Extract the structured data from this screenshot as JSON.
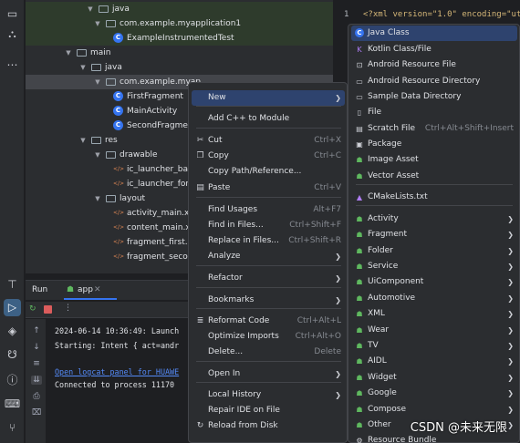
{
  "project_tree": {
    "rows": [
      {
        "label": "java",
        "type": "folder"
      },
      {
        "label": "com.example.myapplication1",
        "type": "folder"
      },
      {
        "label": "ExampleInstrumentedTest",
        "type": "class"
      },
      {
        "label": "main",
        "type": "folder"
      },
      {
        "label": "java",
        "type": "folder"
      },
      {
        "label": "com.example.myap",
        "type": "folder"
      },
      {
        "label": "FirstFragment",
        "type": "class"
      },
      {
        "label": "MainActivity",
        "type": "class"
      },
      {
        "label": "SecondFragmen",
        "type": "class"
      },
      {
        "label": "res",
        "type": "folder"
      },
      {
        "label": "drawable",
        "type": "folder"
      },
      {
        "label": "ic_launcher_back",
        "type": "xml"
      },
      {
        "label": "ic_launcher_fore",
        "type": "xml"
      },
      {
        "label": "layout",
        "type": "folder"
      },
      {
        "label": "activity_main.xm",
        "type": "xml"
      },
      {
        "label": "content_main.xm",
        "type": "xml"
      },
      {
        "label": "fragment_first.xm",
        "type": "xml"
      },
      {
        "label": "fragment_secon",
        "type": "xml"
      }
    ]
  },
  "editor": {
    "line_number": "1",
    "code_line": "<?xml version=\"1.0\" encoding=\"ut"
  },
  "run_panel": {
    "tab_run": "Run",
    "tab_app": "app",
    "lines": [
      "2024-06-14 10:36:49: Launch",
      "Starting: Intent { act=andr",
      "",
      "Open logcat panel for HUAWE",
      "Connected to process 11170"
    ]
  },
  "context_menu": {
    "items": [
      {
        "label": "New",
        "shortcut": "",
        "submenu": true,
        "icon": ""
      },
      {
        "label": "Add C++ to Module",
        "shortcut": "",
        "submenu": false,
        "icon": ""
      },
      {
        "label": "Cut",
        "shortcut": "Ctrl+X",
        "submenu": false,
        "icon": "scissors-icon"
      },
      {
        "label": "Copy",
        "shortcut": "Ctrl+C",
        "submenu": false,
        "icon": "copy-icon"
      },
      {
        "label": "Copy Path/Reference...",
        "shortcut": "",
        "submenu": false,
        "icon": ""
      },
      {
        "label": "Paste",
        "shortcut": "Ctrl+V",
        "submenu": false,
        "icon": "paste-icon"
      },
      {
        "label": "Find Usages",
        "shortcut": "Alt+F7",
        "submenu": false,
        "icon": ""
      },
      {
        "label": "Find in Files...",
        "shortcut": "Ctrl+Shift+F",
        "submenu": false,
        "icon": ""
      },
      {
        "label": "Replace in Files...",
        "shortcut": "Ctrl+Shift+R",
        "submenu": false,
        "icon": ""
      },
      {
        "label": "Analyze",
        "shortcut": "",
        "submenu": true,
        "icon": ""
      },
      {
        "label": "Refactor",
        "shortcut": "",
        "submenu": true,
        "icon": ""
      },
      {
        "label": "Bookmarks",
        "shortcut": "",
        "submenu": true,
        "icon": ""
      },
      {
        "label": "Reformat Code",
        "shortcut": "Ctrl+Alt+L",
        "submenu": false,
        "icon": "reformat-icon"
      },
      {
        "label": "Optimize Imports",
        "shortcut": "Ctrl+Alt+O",
        "submenu": false,
        "icon": ""
      },
      {
        "label": "Delete...",
        "shortcut": "Delete",
        "submenu": false,
        "icon": ""
      },
      {
        "label": "Open In",
        "shortcut": "",
        "submenu": true,
        "icon": ""
      },
      {
        "label": "Local History",
        "shortcut": "",
        "submenu": true,
        "icon": ""
      },
      {
        "label": "Repair IDE on File",
        "shortcut": "",
        "submenu": false,
        "icon": ""
      },
      {
        "label": "Reload from Disk",
        "shortcut": "",
        "submenu": false,
        "icon": "reload-icon"
      }
    ]
  },
  "new_submenu": {
    "items": [
      {
        "label": "Java Class",
        "shortcut": "",
        "submenu": false,
        "icon": "java-class-icon"
      },
      {
        "label": "Kotlin Class/File",
        "shortcut": "",
        "submenu": false,
        "icon": "kotlin-icon"
      },
      {
        "label": "Android Resource File",
        "shortcut": "",
        "submenu": false,
        "icon": "resource-file-icon"
      },
      {
        "label": "Android Resource Directory",
        "shortcut": "",
        "submenu": false,
        "icon": "folder-icon"
      },
      {
        "label": "Sample Data Directory",
        "shortcut": "",
        "submenu": false,
        "icon": "folder-icon"
      },
      {
        "label": "File",
        "shortcut": "",
        "submenu": false,
        "icon": "file-icon"
      },
      {
        "label": "Scratch File",
        "shortcut": "Ctrl+Alt+Shift+Insert",
        "submenu": false,
        "icon": "scratch-file-icon"
      },
      {
        "label": "Package",
        "shortcut": "",
        "submenu": false,
        "icon": "package-icon"
      },
      {
        "label": "Image Asset",
        "shortcut": "",
        "submenu": false,
        "icon": "android-icon"
      },
      {
        "label": "Vector Asset",
        "shortcut": "",
        "submenu": false,
        "icon": "android-icon"
      },
      {
        "label": "CMakeLists.txt",
        "shortcut": "",
        "submenu": false,
        "icon": "cmake-icon"
      },
      {
        "label": "Activity",
        "shortcut": "",
        "submenu": true,
        "icon": "android-icon"
      },
      {
        "label": "Fragment",
        "shortcut": "",
        "submenu": true,
        "icon": "android-icon"
      },
      {
        "label": "Folder",
        "shortcut": "",
        "submenu": true,
        "icon": "android-icon"
      },
      {
        "label": "Service",
        "shortcut": "",
        "submenu": true,
        "icon": "android-icon"
      },
      {
        "label": "UiComponent",
        "shortcut": "",
        "submenu": true,
        "icon": "android-icon"
      },
      {
        "label": "Automotive",
        "shortcut": "",
        "submenu": true,
        "icon": "android-icon"
      },
      {
        "label": "XML",
        "shortcut": "",
        "submenu": true,
        "icon": "android-icon"
      },
      {
        "label": "Wear",
        "shortcut": "",
        "submenu": true,
        "icon": "android-icon"
      },
      {
        "label": "TV",
        "shortcut": "",
        "submenu": true,
        "icon": "android-icon"
      },
      {
        "label": "AIDL",
        "shortcut": "",
        "submenu": true,
        "icon": "android-icon"
      },
      {
        "label": "Widget",
        "shortcut": "",
        "submenu": true,
        "icon": "android-icon"
      },
      {
        "label": "Google",
        "shortcut": "",
        "submenu": true,
        "icon": "android-icon"
      },
      {
        "label": "Compose",
        "shortcut": "",
        "submenu": true,
        "icon": "android-icon"
      },
      {
        "label": "Other",
        "shortcut": "",
        "submenu": true,
        "icon": "android-icon"
      },
      {
        "label": "Resource Bundle",
        "shortcut": "",
        "submenu": false,
        "icon": "resource-bundle-icon"
      }
    ]
  },
  "watermark": "CSDN @未来无限",
  "colors": {
    "background": "#1e1f22",
    "panel": "#2b2d30",
    "highlight": "#2e436e",
    "accent_blue": "#3574f0",
    "android_green": "#5fb85f"
  }
}
